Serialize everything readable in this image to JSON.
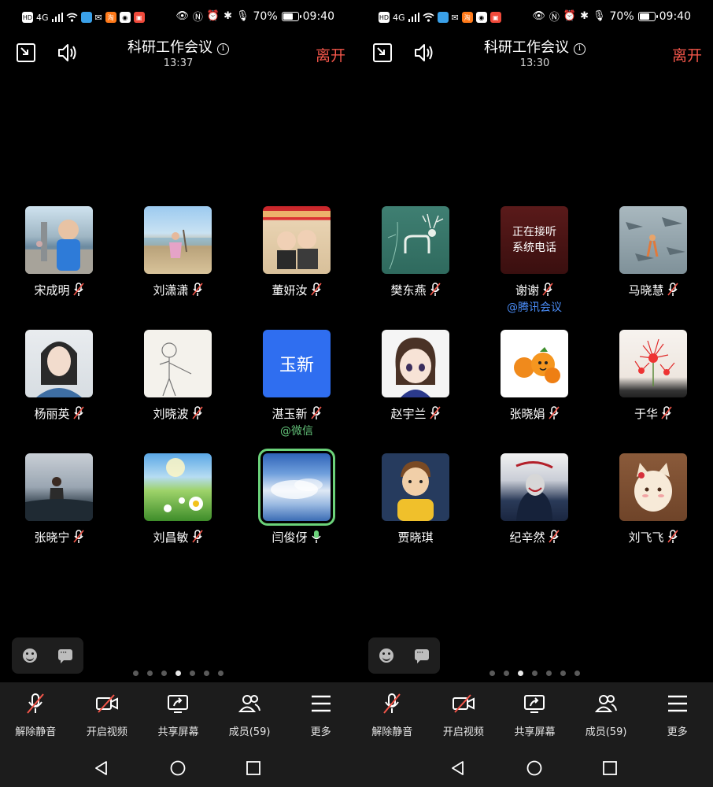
{
  "screens": [
    {
      "status": {
        "left_icons": [
          "HD",
          "4G",
          "signal-icon",
          "wifi-icon",
          "app-icon-chat",
          "wechat-icon",
          "taobao-icon",
          "app-icon-shield",
          "app-icon-red"
        ],
        "battery": "70%",
        "battery_level": 0.7,
        "time": "09:40"
      },
      "header": {
        "title": "科研工作会议",
        "time": "13:37",
        "leave_label": "离开"
      },
      "participants": [
        {
          "name": "宋成明",
          "mic": "muted",
          "sub": ""
        },
        {
          "name": "刘潇潇",
          "mic": "muted",
          "sub": ""
        },
        {
          "name": "董妍汝",
          "mic": "muted",
          "sub": ""
        },
        {
          "name": "杨丽英",
          "mic": "muted",
          "sub": ""
        },
        {
          "name": "刘晓波",
          "mic": "muted",
          "sub": ""
        },
        {
          "name": "湛玉新",
          "mic": "muted",
          "sub": "@微信",
          "avatar_text": "玉新"
        },
        {
          "name": "张晓宁",
          "mic": "muted",
          "sub": ""
        },
        {
          "name": "刘昌敏",
          "mic": "muted",
          "sub": ""
        },
        {
          "name": "闫俊伢",
          "mic": "active",
          "sub": "",
          "speaking": true
        }
      ],
      "page_dots": {
        "count": 7,
        "active": 3
      },
      "toolbar": [
        {
          "label": "解除静音",
          "icon": "mic-muted-icon"
        },
        {
          "label": "开启视频",
          "icon": "video-off-icon"
        },
        {
          "label": "共享屏幕",
          "icon": "share-screen-icon"
        },
        {
          "label": "成员(59)",
          "icon": "members-icon"
        },
        {
          "label": "更多",
          "icon": "menu-icon"
        }
      ]
    },
    {
      "status": {
        "left_icons": [
          "HD",
          "4G",
          "signal-icon",
          "wifi-icon",
          "app-icon-chat",
          "wechat-icon",
          "taobao-icon",
          "app-icon-shield",
          "app-icon-red"
        ],
        "battery": "70%",
        "battery_level": 0.7,
        "time": "09:40"
      },
      "header": {
        "title": "科研工作会议",
        "time": "13:30",
        "leave_label": "离开"
      },
      "participants": [
        {
          "name": "樊东燕",
          "mic": "muted",
          "sub": ""
        },
        {
          "name": "谢谢",
          "mic": "muted",
          "sub": "@腾讯会议",
          "avatar_text": "正在接听\n系统电话"
        },
        {
          "name": "马晓慧",
          "mic": "muted",
          "sub": ""
        },
        {
          "name": "赵宇兰",
          "mic": "muted",
          "sub": ""
        },
        {
          "name": "张晓娟",
          "mic": "muted",
          "sub": ""
        },
        {
          "name": "于华",
          "mic": "muted",
          "sub": ""
        },
        {
          "name": "贾晓琪",
          "mic": "none",
          "sub": ""
        },
        {
          "name": "纪辛然",
          "mic": "muted",
          "sub": ""
        },
        {
          "name": "刘飞飞",
          "mic": "muted",
          "sub": ""
        }
      ],
      "page_dots": {
        "count": 7,
        "active": 2
      },
      "toolbar": [
        {
          "label": "解除静音",
          "icon": "mic-muted-icon"
        },
        {
          "label": "开启视频",
          "icon": "video-off-icon"
        },
        {
          "label": "共享屏幕",
          "icon": "share-screen-icon"
        },
        {
          "label": "成员(59)",
          "icon": "members-icon"
        },
        {
          "label": "更多",
          "icon": "menu-icon"
        }
      ]
    }
  ],
  "colors": {
    "leave": "#f4564a",
    "speaking_outline": "#6bd27a",
    "wechat_tag": "#64c47a",
    "tencent_tag": "#4a8cf6",
    "toolbar_bg": "#1c1c1c"
  }
}
